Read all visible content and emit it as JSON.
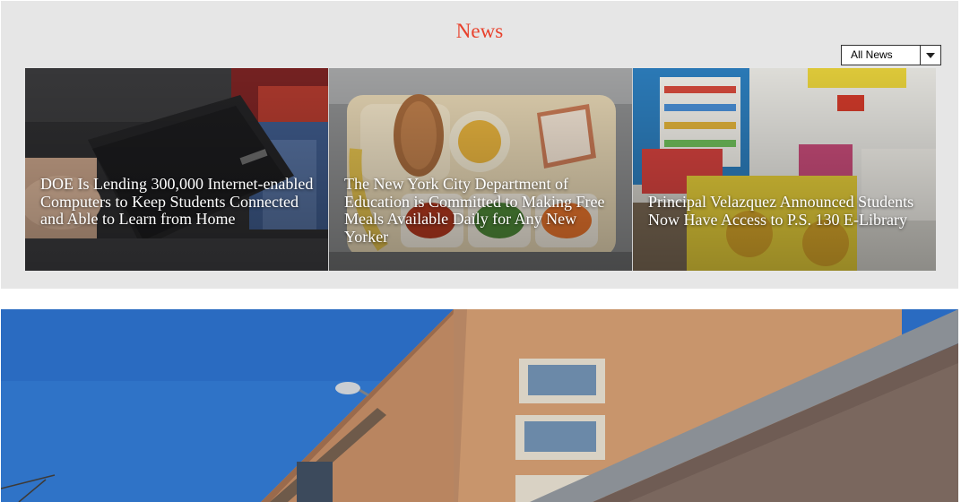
{
  "news": {
    "title": "News",
    "filter": {
      "selected": "All News",
      "icon": "chevron-down-icon"
    },
    "cards": [
      {
        "title": "DOE Is Lending 300,000 Internet-enabled Computers to Keep Students Connected and Able to Learn from Home",
        "image": "laptop-photo"
      },
      {
        "title": "The New York City Department of Education is Committed to Making Free Meals Available Daily for Any New Yorker",
        "image": "lunch-tray-photo"
      },
      {
        "title": "Principal Velazquez Announced Students Now Have Access to P.S. 130 E-Library",
        "image": "library-classroom-photo"
      }
    ],
    "card_text_color": "#ffffff",
    "accent_color": "#e8412c"
  },
  "hero": {
    "image": "school-building-photo"
  }
}
